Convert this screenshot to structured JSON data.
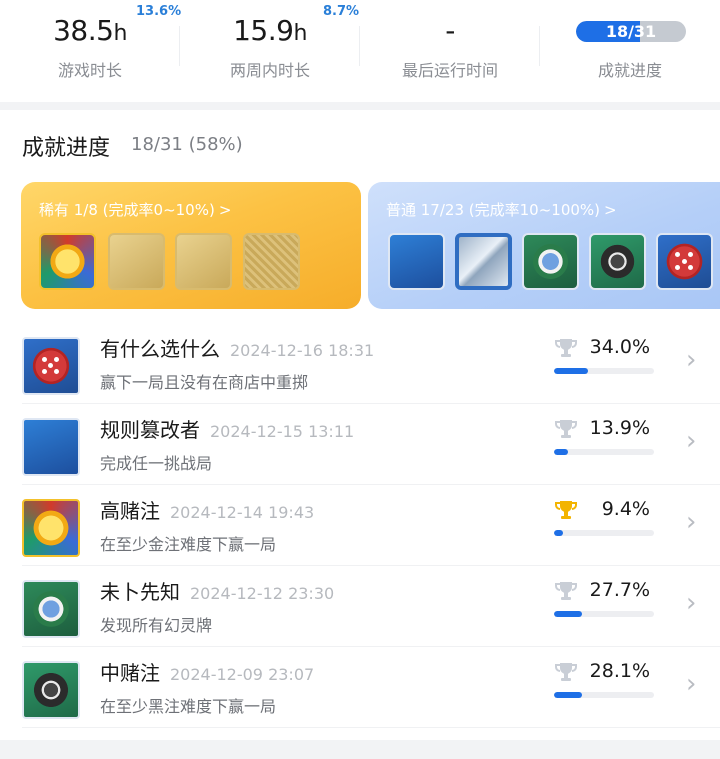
{
  "stats": {
    "play_time": {
      "value": "38.5",
      "unit": "h",
      "delta": "13.6%",
      "label": "游戏时长"
    },
    "two_weeks": {
      "value": "15.9",
      "unit": "h",
      "delta": "8.7%",
      "label": "两周内时长"
    },
    "last_run": {
      "value": "-",
      "label": "最后运行时间"
    },
    "achievement": {
      "text": "18/31",
      "progress": 0.58,
      "label": "成就进度"
    }
  },
  "section": {
    "title": "成就进度",
    "summary": "18/31 (58%)"
  },
  "tiers": {
    "rare": {
      "label": "稀有 1/8 (完成率0~10%)",
      "chevron": ">",
      "badges": [
        "gold-chip-badge",
        "jester-badge",
        "joker-badge",
        "card-back-badge"
      ]
    },
    "common": {
      "label": "普通 17/23 (完成率10~100%)",
      "chevron": ">",
      "badges": [
        "rule-rewriter-badge",
        "glass-card-badge",
        "tarot-chip-badge",
        "black-chip-badge",
        "dice-badge"
      ]
    }
  },
  "achievements": [
    {
      "name": "有什么选什么",
      "date": "2024-12-16 18:31",
      "desc": "赢下一局且没有在商店中重掷",
      "rate": "34.0%",
      "rate_value": 0.34,
      "trophy": "silver",
      "icon": "dice-icon"
    },
    {
      "name": "规则篡改者",
      "date": "2024-12-15 13:11",
      "desc": "完成任一挑战局",
      "rate": "13.9%",
      "rate_value": 0.139,
      "trophy": "silver",
      "icon": "rule-icon"
    },
    {
      "name": "高赌注",
      "date": "2024-12-14 19:43",
      "desc": "在至少金注难度下赢一局",
      "rate": "9.4%",
      "rate_value": 0.094,
      "trophy": "gold",
      "icon": "gold-chip-icon"
    },
    {
      "name": "未卜先知",
      "date": "2024-12-12 23:30",
      "desc": "发现所有幻灵牌",
      "rate": "27.7%",
      "rate_value": 0.277,
      "trophy": "silver",
      "icon": "tarot-chip-icon"
    },
    {
      "name": "中赌注",
      "date": "2024-12-09 23:07",
      "desc": "在至少黑注难度下赢一局",
      "rate": "28.1%",
      "rate_value": 0.281,
      "trophy": "silver",
      "icon": "black-chip-icon"
    }
  ],
  "colors": {
    "accent": "#1e6fe6",
    "delta": "#2a7fd8",
    "rare": "#fcc244",
    "common": "#b5cff8",
    "gold_trophy": "#f3b400",
    "silver_trophy": "#c9ced6"
  }
}
